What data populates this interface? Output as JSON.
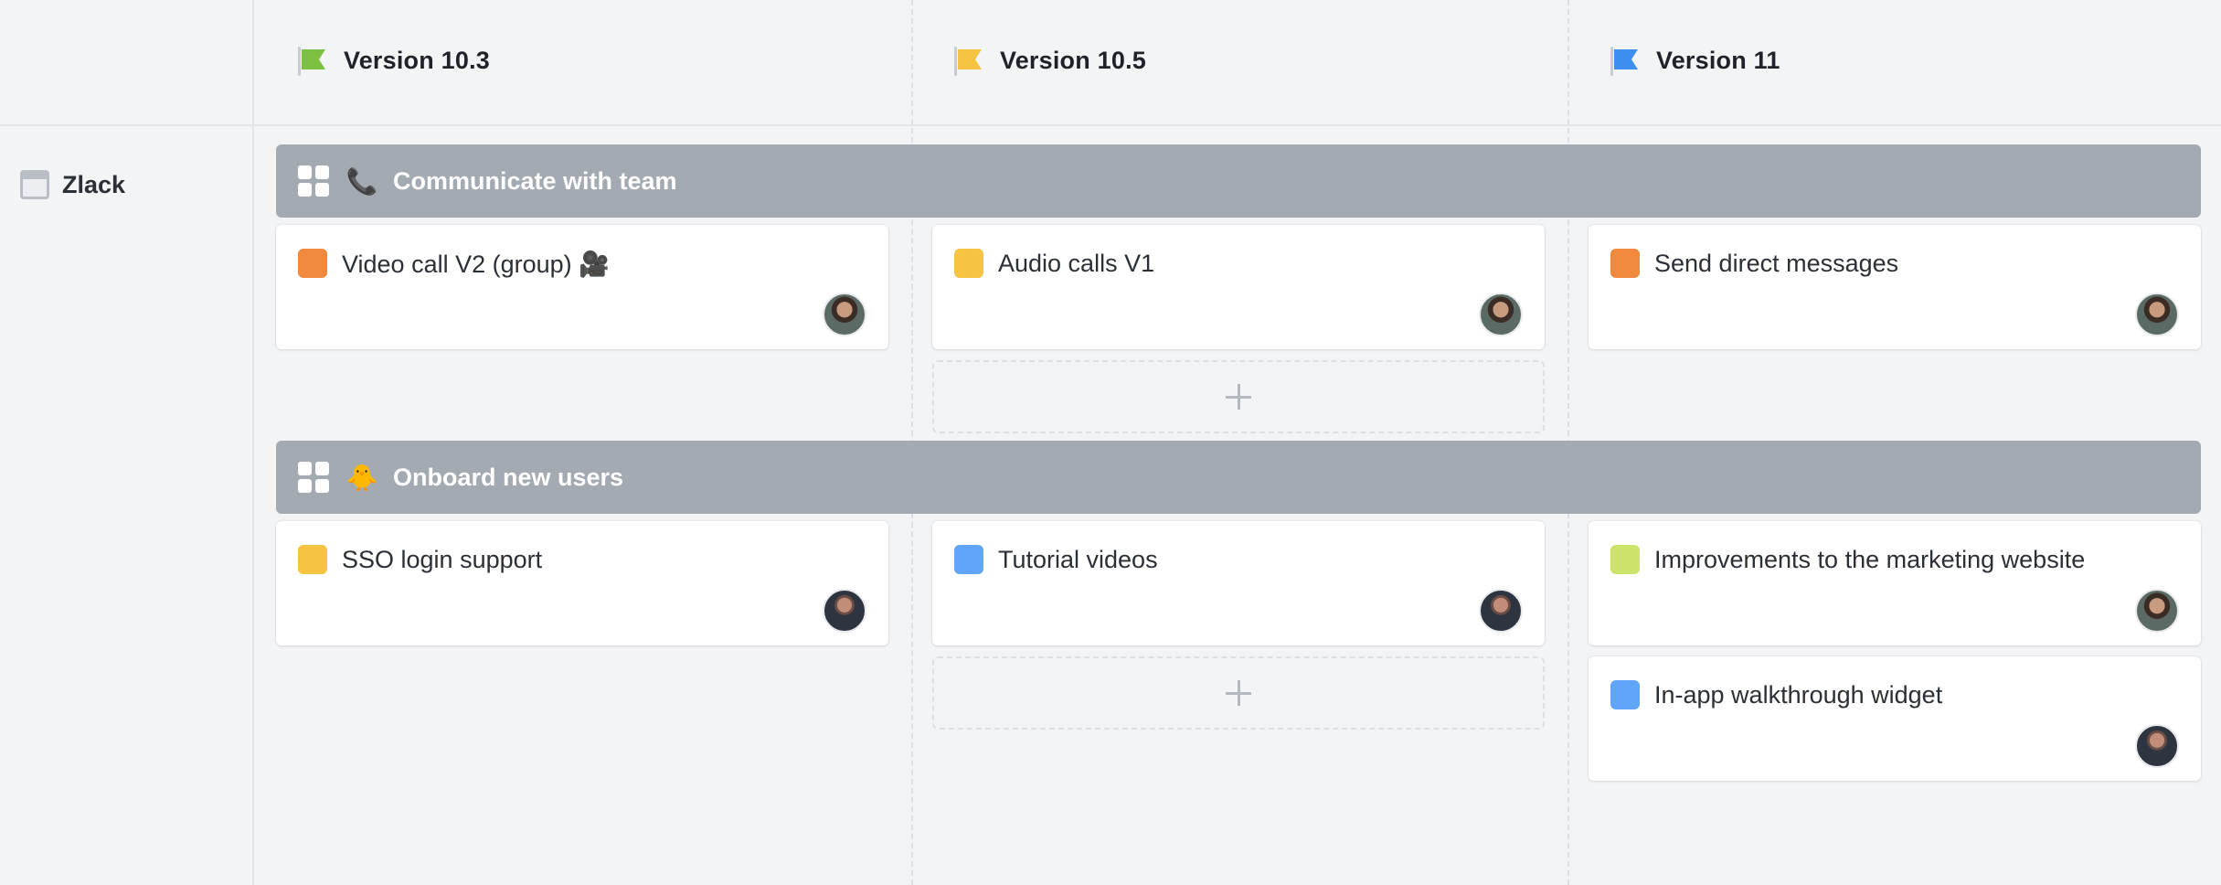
{
  "releases": [
    {
      "name": "Version 10.3",
      "flag_color": "#7cc142"
    },
    {
      "name": "Version 10.5",
      "flag_color": "#f6c343"
    },
    {
      "name": "Version 11",
      "flag_color": "#3d8ff0"
    }
  ],
  "product": {
    "name": "Zlack",
    "icon": "window-icon"
  },
  "goals": [
    {
      "title": "Communicate with team",
      "emoji": "📞",
      "icon": "telephone-icon",
      "features": [
        {
          "release": "Version 10.3",
          "title": "Video call V2 (group) 🎥",
          "status_color": "#f0883e",
          "assignee": "avatar-woman"
        },
        {
          "release": "Version 10.5",
          "title": "Audio calls V1",
          "status_color": "#f6c343",
          "assignee": "avatar-woman"
        },
        {
          "release": "Version 11",
          "title": "Send direct messages",
          "status_color": "#f0883e",
          "assignee": "avatar-woman"
        }
      ]
    },
    {
      "title": "Onboard new users",
      "emoji": "🐥",
      "icon": "chick-icon",
      "features": [
        {
          "release": "Version 10.3",
          "title": "SSO login support",
          "status_color": "#f6c343",
          "assignee": "avatar-man"
        },
        {
          "release": "Version 10.5",
          "title": "Tutorial videos",
          "status_color": "#60a5f8",
          "assignee": "avatar-man"
        },
        {
          "release": "Version 11",
          "title": "Improvements to the marketing website",
          "status_color": "#cde46a",
          "assignee": "avatar-woman"
        },
        {
          "release": "Version 11",
          "title": "In-app walkthrough widget",
          "status_color": "#60a5f8",
          "assignee": "avatar-man"
        }
      ]
    }
  ],
  "add_slots": [
    {
      "goal": "Communicate with team",
      "release": "Version 10.5",
      "icon": "plus-icon"
    },
    {
      "goal": "Onboard new users",
      "release": "Version 10.5",
      "icon": "plus-icon"
    }
  ],
  "colors": {
    "background": "#f3f4f6",
    "goal_band": "#a3aab1",
    "card": "#ffffff"
  }
}
